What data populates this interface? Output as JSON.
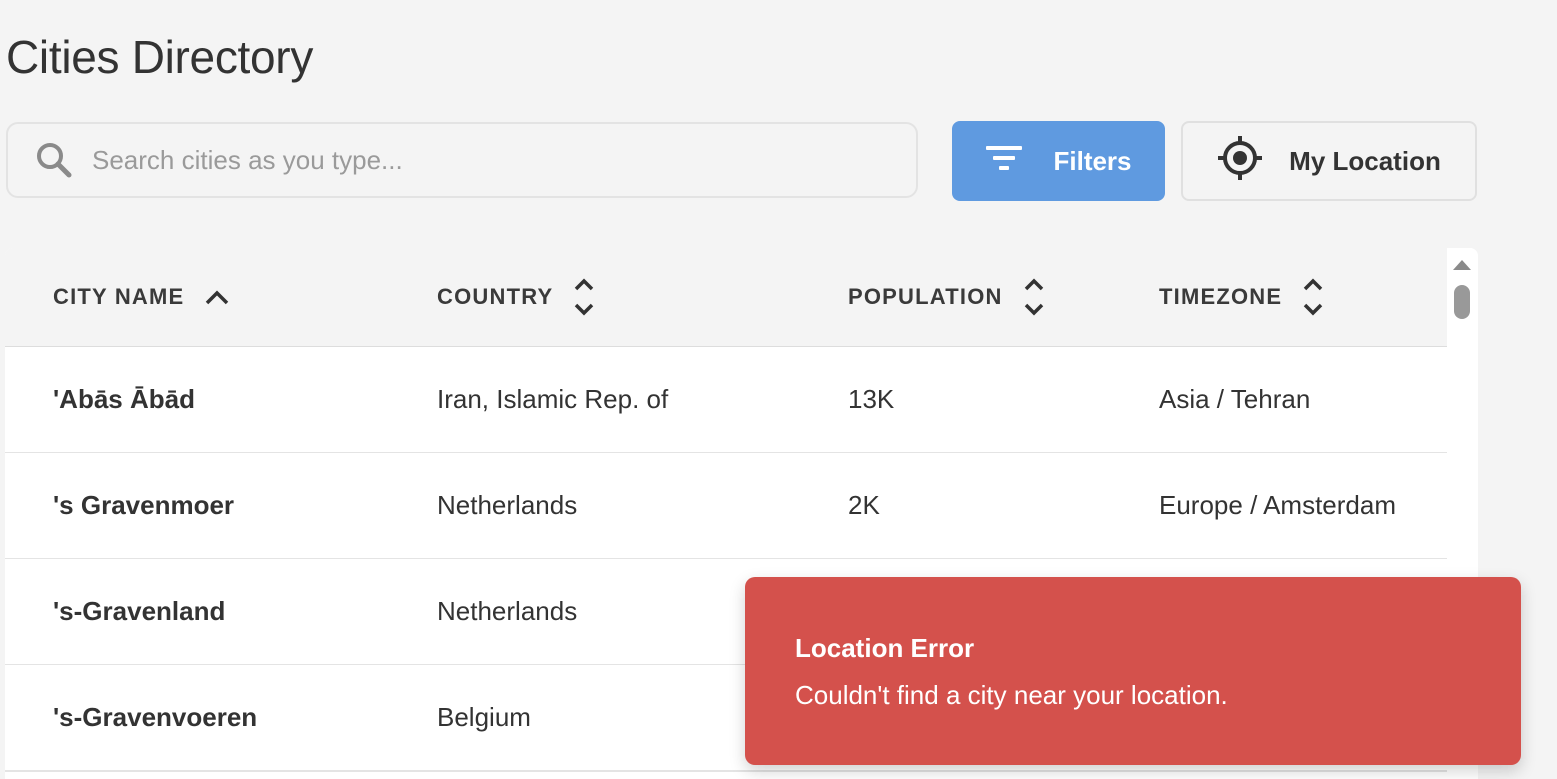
{
  "page": {
    "title": "Cities Directory"
  },
  "search": {
    "placeholder": "Search cities as you type...",
    "value": "",
    "icon": "search-icon"
  },
  "toolbar": {
    "filters_label": "Filters",
    "filters_icon": "filter-icon",
    "location_label": "My Location",
    "location_icon": "crosshair-icon"
  },
  "colors": {
    "accent": "#5f9ae0",
    "error": "#d4514c",
    "background": "#f4f4f4"
  },
  "table": {
    "columns": [
      {
        "label": "CITY NAME",
        "sort": "ascending"
      },
      {
        "label": "COUNTRY",
        "sort": "none"
      },
      {
        "label": "POPULATION",
        "sort": "none"
      },
      {
        "label": "TIMEZONE",
        "sort": "none"
      }
    ],
    "rows": [
      {
        "city": "'Abās Ābād",
        "country": "Iran, Islamic Rep. of",
        "population": "13K",
        "timezone": "Asia / Tehran"
      },
      {
        "city": "'s Gravenmoer",
        "country": "Netherlands",
        "population": "2K",
        "timezone": "Europe / Amsterdam"
      },
      {
        "city": "'s-Gravenland",
        "country": "Netherlands",
        "population": "",
        "timezone": ""
      },
      {
        "city": "'s-Gravenvoeren",
        "country": "Belgium",
        "population": "",
        "timezone": ""
      }
    ]
  },
  "toast": {
    "title": "Location Error",
    "message": "Couldn't find a city near your location."
  }
}
